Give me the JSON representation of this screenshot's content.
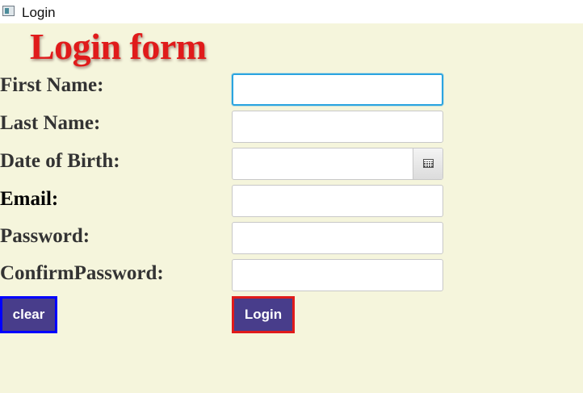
{
  "window": {
    "title": "Login"
  },
  "form": {
    "title": "Login form",
    "fields": {
      "first_name": {
        "label": "First Name:",
        "value": ""
      },
      "last_name": {
        "label": "Last Name:",
        "value": ""
      },
      "date_of_birth": {
        "label": "Date of Birth:",
        "value": "",
        "icon": "calendar-icon"
      },
      "email": {
        "label": "Email:",
        "value": ""
      },
      "password": {
        "label": "Password:",
        "value": ""
      },
      "confirm_password": {
        "label": "ConfirmPassword:",
        "value": ""
      }
    },
    "buttons": {
      "clear_label": "clear",
      "login_label": "Login"
    }
  },
  "colors": {
    "background": "#f5f5dc",
    "title": "#e01b1b",
    "button_fill": "#483d8b",
    "clear_border": "#0000ff",
    "login_border": "#e01b1b",
    "focus_ring": "#2ba4e0"
  }
}
